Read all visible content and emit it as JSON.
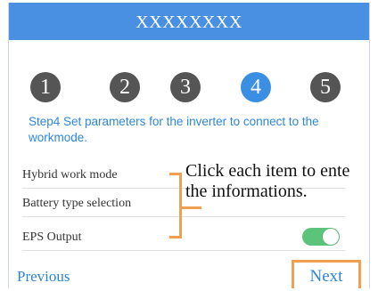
{
  "header": {
    "title": "XXXXXXXX"
  },
  "steps": [
    {
      "number": "1",
      "active": false
    },
    {
      "number": "2",
      "active": false
    },
    {
      "number": "3",
      "active": false
    },
    {
      "number": "4",
      "active": true
    },
    {
      "number": "5",
      "active": false
    }
  ],
  "description": "Step4 Set parameters for the inverter to connect to the workmode.",
  "items": [
    {
      "label": "Hybrid work mode"
    },
    {
      "label": "Battery type selection"
    },
    {
      "label": "EPS Output",
      "toggle_on": true
    }
  ],
  "annotation": {
    "line1": "Click each item to ente",
    "line2": "the informations."
  },
  "footer": {
    "previous_label": "Previous",
    "next_label": "Next"
  },
  "colors": {
    "accent": "#4a90e2",
    "active_step": "#3b8fe3",
    "inactive_step": "#555555",
    "toggle_on": "#5cc47a",
    "annotation": "#f0a050",
    "link": "#2d86dd"
  }
}
